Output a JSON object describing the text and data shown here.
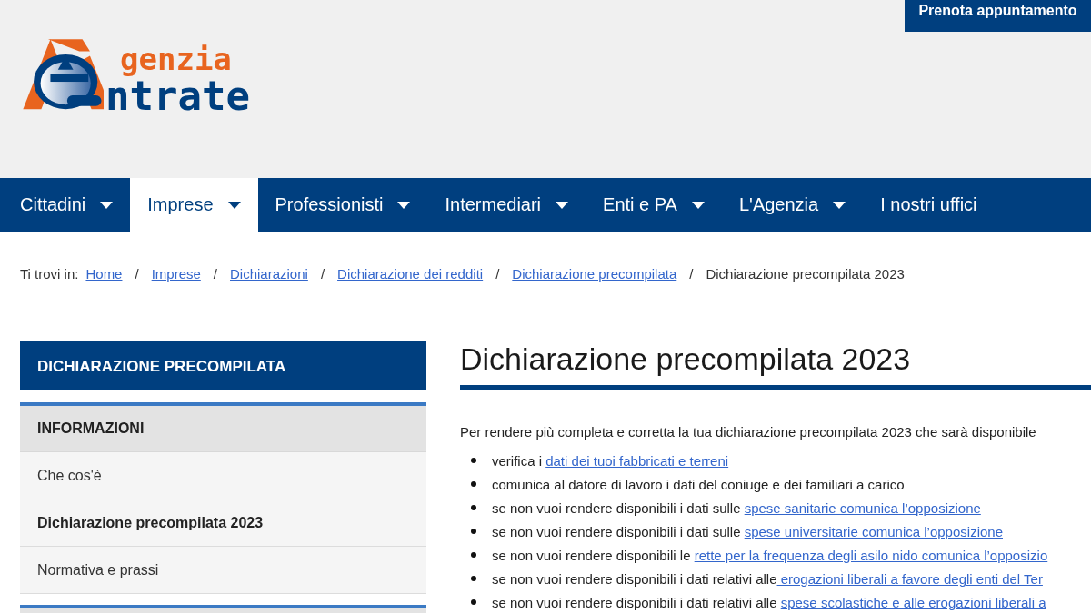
{
  "top_button": "Prenota appuntamento",
  "logo": {
    "line_1": "genzia",
    "line_2": "ntrate"
  },
  "nav": [
    {
      "label": "Cittadini",
      "has_menu": true,
      "selected": false
    },
    {
      "label": "Imprese",
      "has_menu": true,
      "selected": true
    },
    {
      "label": "Professionisti",
      "has_menu": true,
      "selected": false
    },
    {
      "label": "Intermediari",
      "has_menu": true,
      "selected": false
    },
    {
      "label": "Enti e PA",
      "has_menu": true,
      "selected": false
    },
    {
      "label": "L'Agenzia",
      "has_menu": true,
      "selected": false
    },
    {
      "label": "I nostri uffici",
      "has_menu": false,
      "selected": false
    }
  ],
  "breadcrumb": {
    "prefix": "Ti trovi in:",
    "links": [
      "Home",
      "Imprese",
      "Dichiarazioni",
      "Dichiarazione dei redditi",
      "Dichiarazione precompilata"
    ],
    "current": "Dichiarazione precompilata 2023",
    "separator": "/"
  },
  "sidebar": {
    "title": "DICHIARAZIONE PRECOMPILATA",
    "section": "INFORMAZIONI",
    "items": [
      {
        "label": "Che cos'è",
        "selected": false
      },
      {
        "label": "Dichiarazione precompilata 2023",
        "selected": true
      },
      {
        "label": "Normativa e prassi",
        "selected": false
      }
    ]
  },
  "main": {
    "title": "Dichiarazione precompilata 2023",
    "intro": "Per rendere più completa e corretta la tua dichiarazione precompilata 2023 che sarà disponibile",
    "bullets": [
      {
        "text": "verifica i ",
        "link": "dati dei tuoi fabbricati e terreni"
      },
      {
        "text": "comunica al datore di lavoro i dati del coniuge e dei familiari a carico"
      },
      {
        "text": "se non vuoi rendere disponibili i dati sulle ",
        "link": "spese sanitarie comunica l’opposizione"
      },
      {
        "text": "se non vuoi rendere disponibili i dati sulle ",
        "link": "spese universitarie comunica l’opposizione"
      },
      {
        "text": "se non vuoi rendere disponibili le ",
        "link": "rette per la frequenza degli asilo nido comunica l’opposizio"
      },
      {
        "text": "se non vuoi rendere disponibili i dati relativi alle",
        "link": " erogazioni liberali a favore degli enti del Ter"
      },
      {
        "text": "se non vuoi rendere disponibili i dati relativi alle ",
        "link": "spese scolastiche e alle erogazioni liberali a"
      }
    ]
  }
}
